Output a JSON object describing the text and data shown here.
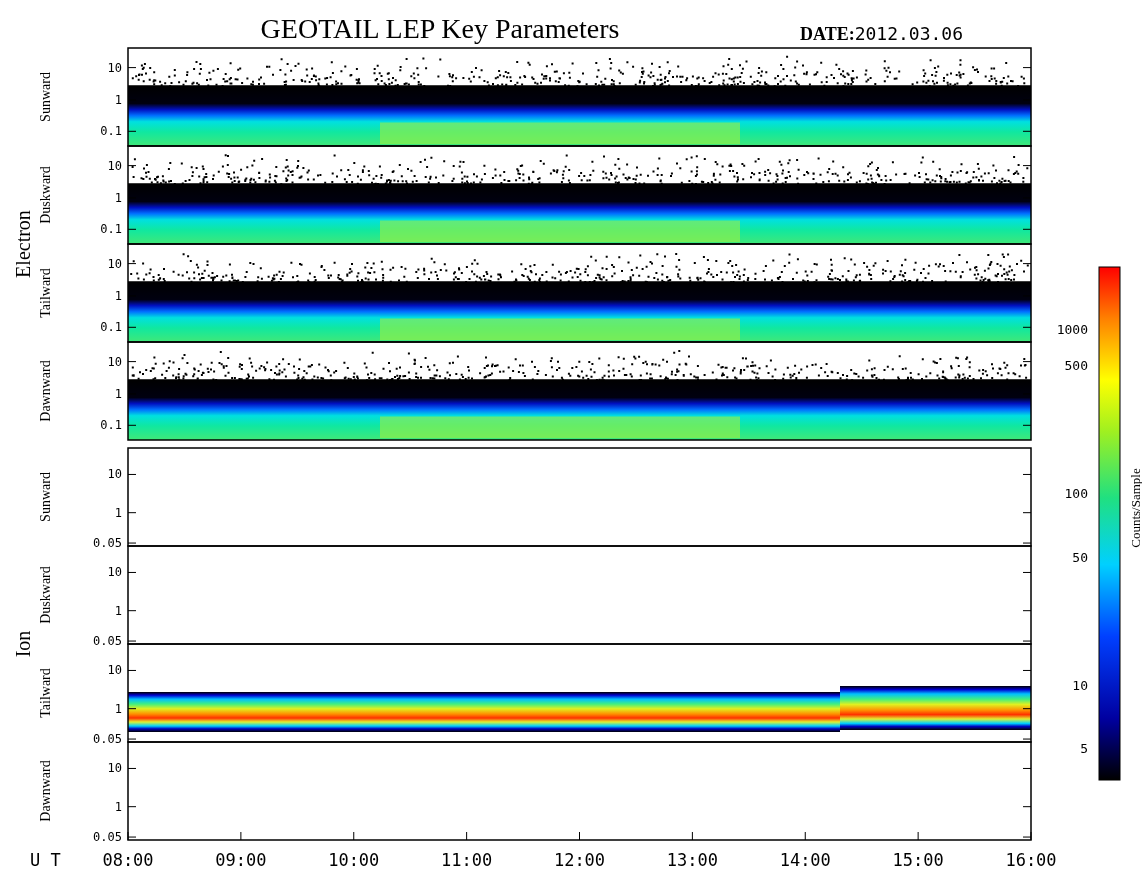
{
  "title": "GEOTAIL LEP Key Parameters",
  "date_label": "DATE:",
  "date": "2012.03.06",
  "groups": [
    {
      "name": "Electron",
      "panels": [
        {
          "direction": "Sunward",
          "kind": "electron",
          "yticks": [
            "10",
            "1",
            "0.1"
          ]
        },
        {
          "direction": "Duskward",
          "kind": "electron",
          "yticks": [
            "10",
            "1",
            "0.1"
          ]
        },
        {
          "direction": "Tailward",
          "kind": "electron",
          "yticks": [
            "10",
            "1",
            "0.1"
          ]
        },
        {
          "direction": "Dawnward",
          "kind": "electron",
          "yticks": [
            "10",
            "1",
            "0.1"
          ]
        }
      ]
    },
    {
      "name": "Ion",
      "panels": [
        {
          "direction": "Sunward",
          "kind": "empty",
          "yticks": [
            "10",
            "1",
            "0.05"
          ]
        },
        {
          "direction": "Duskward",
          "kind": "empty",
          "yticks": [
            "10",
            "1",
            "0.05"
          ]
        },
        {
          "direction": "Tailward",
          "kind": "ion_band",
          "yticks": [
            "10",
            "1",
            "0.05"
          ]
        },
        {
          "direction": "Dawnward",
          "kind": "empty",
          "yticks": [
            "10",
            "1",
            "0.05"
          ]
        }
      ]
    }
  ],
  "x_axis": {
    "label": "U T",
    "ticks": [
      "08:00",
      "09:00",
      "10:00",
      "11:00",
      "12:00",
      "13:00",
      "14:00",
      "15:00",
      "16:00"
    ]
  },
  "colorbar": {
    "label": "Counts/Sample",
    "ticks": [
      "1000",
      "500",
      "100",
      "50",
      "10",
      "5"
    ]
  }
}
